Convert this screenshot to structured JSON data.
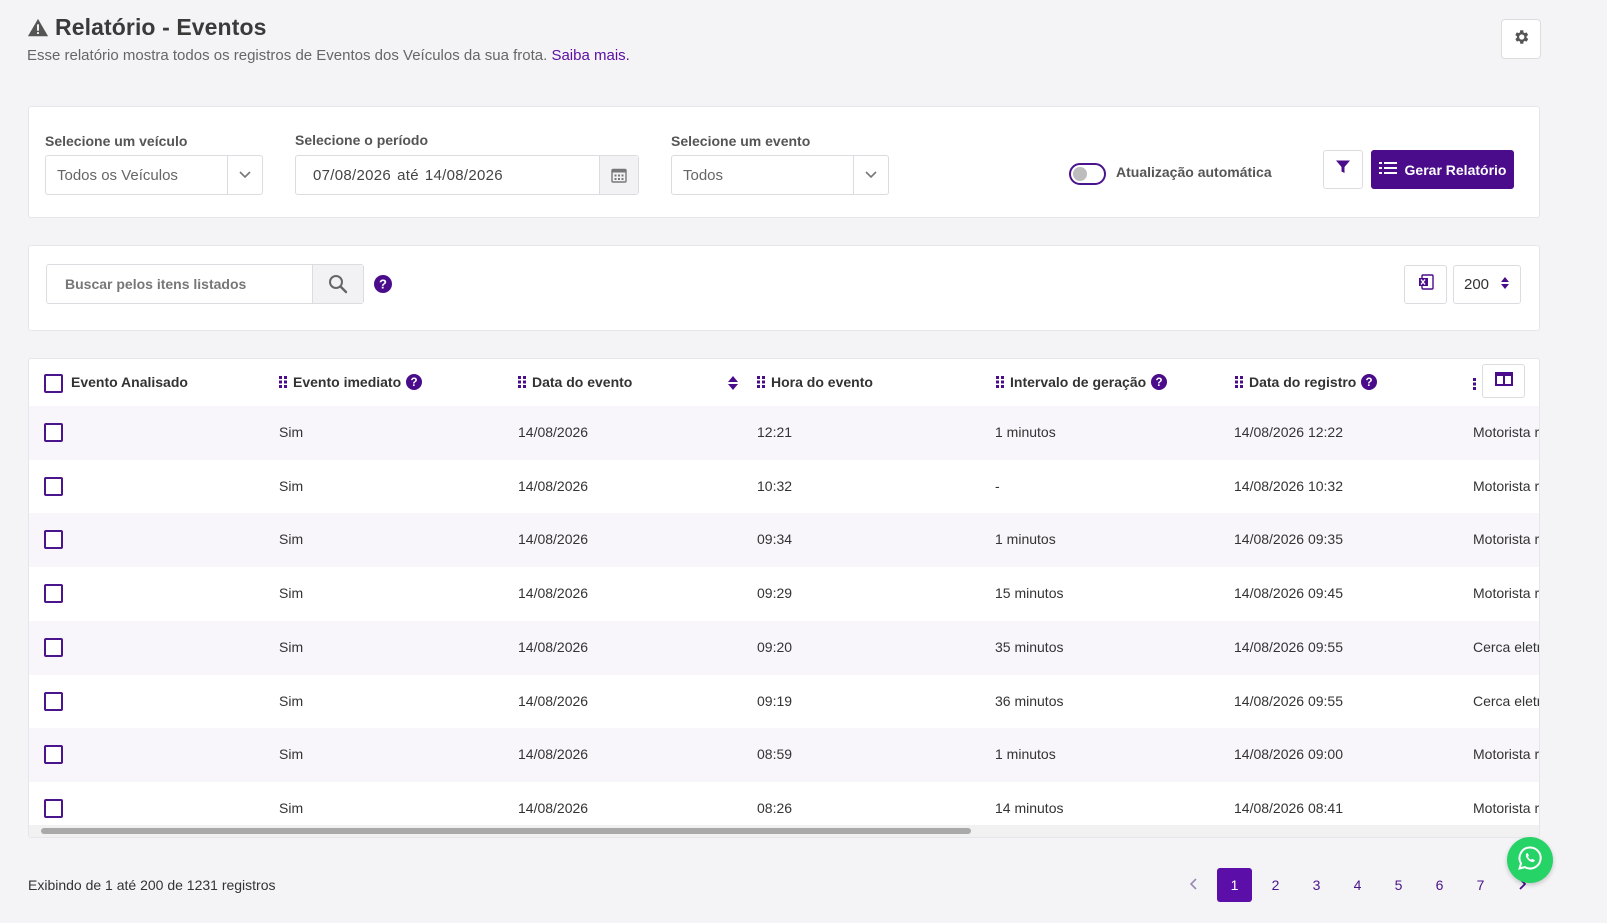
{
  "header": {
    "title": "Relatório - Eventos",
    "subtitle": "Esse relatório mostra todos os registros de Eventos dos Veículos da sua frota.",
    "learn_more": "Saiba mais."
  },
  "filters": {
    "vehicle_label": "Selecione um veículo",
    "vehicle_value": "Todos os Veículos",
    "period_label": "Selecione o período",
    "period_start": "07/08/2026",
    "period_sep": "até",
    "period_end": "14/08/2026",
    "event_label": "Selecione um evento",
    "event_value": "Todos",
    "auto_update_label": "Atualização automática",
    "auto_update_on": false,
    "generate_label": "Gerar Relatório"
  },
  "search": {
    "placeholder": "Buscar pelos itens listados",
    "page_size": "200"
  },
  "table": {
    "columns": [
      "Evento Analisado",
      "Evento imediato",
      "Data do evento",
      "Hora do evento",
      "Intervalo de geração",
      "Data do registro"
    ],
    "rows": [
      {
        "imediato": "Sim",
        "data": "14/08/2026",
        "hora": "12:21",
        "intervalo": "1 minutos",
        "registro": "14/08/2026 12:22",
        "extra": "Motorista r"
      },
      {
        "imediato": "Sim",
        "data": "14/08/2026",
        "hora": "10:32",
        "intervalo": "-",
        "registro": "14/08/2026 10:32",
        "extra": "Motorista r"
      },
      {
        "imediato": "Sim",
        "data": "14/08/2026",
        "hora": "09:34",
        "intervalo": "1 minutos",
        "registro": "14/08/2026 09:35",
        "extra": "Motorista r"
      },
      {
        "imediato": "Sim",
        "data": "14/08/2026",
        "hora": "09:29",
        "intervalo": "15 minutos",
        "registro": "14/08/2026 09:45",
        "extra": "Motorista r"
      },
      {
        "imediato": "Sim",
        "data": "14/08/2026",
        "hora": "09:20",
        "intervalo": "35 minutos",
        "registro": "14/08/2026 09:55",
        "extra": "Cerca eletr"
      },
      {
        "imediato": "Sim",
        "data": "14/08/2026",
        "hora": "09:19",
        "intervalo": "36 minutos",
        "registro": "14/08/2026 09:55",
        "extra": "Cerca eletr"
      },
      {
        "imediato": "Sim",
        "data": "14/08/2026",
        "hora": "08:59",
        "intervalo": "1 minutos",
        "registro": "14/08/2026 09:00",
        "extra": "Motorista r"
      },
      {
        "imediato": "Sim",
        "data": "14/08/2026",
        "hora": "08:26",
        "intervalo": "14 minutos",
        "registro": "14/08/2026 08:41",
        "extra": "Motorista r"
      }
    ]
  },
  "footer": {
    "info": "Exibindo de 1 até 200 de 1231 registros",
    "pages": [
      "1",
      "2",
      "3",
      "4",
      "5",
      "6",
      "7"
    ],
    "active_page": "1"
  },
  "colors": {
    "primary": "#4a0c8a",
    "accent_link": "#5a0fa0",
    "whatsapp": "#25d366"
  },
  "icons": [
    "warning-icon",
    "gear-icon",
    "chevron-down-icon",
    "calendar-icon",
    "filter-icon",
    "list-icon",
    "search-icon",
    "help-icon",
    "excel-icon",
    "sort-icon",
    "grip-icon",
    "columns-icon",
    "chevron-left-icon",
    "chevron-right-icon",
    "whatsapp-icon"
  ]
}
